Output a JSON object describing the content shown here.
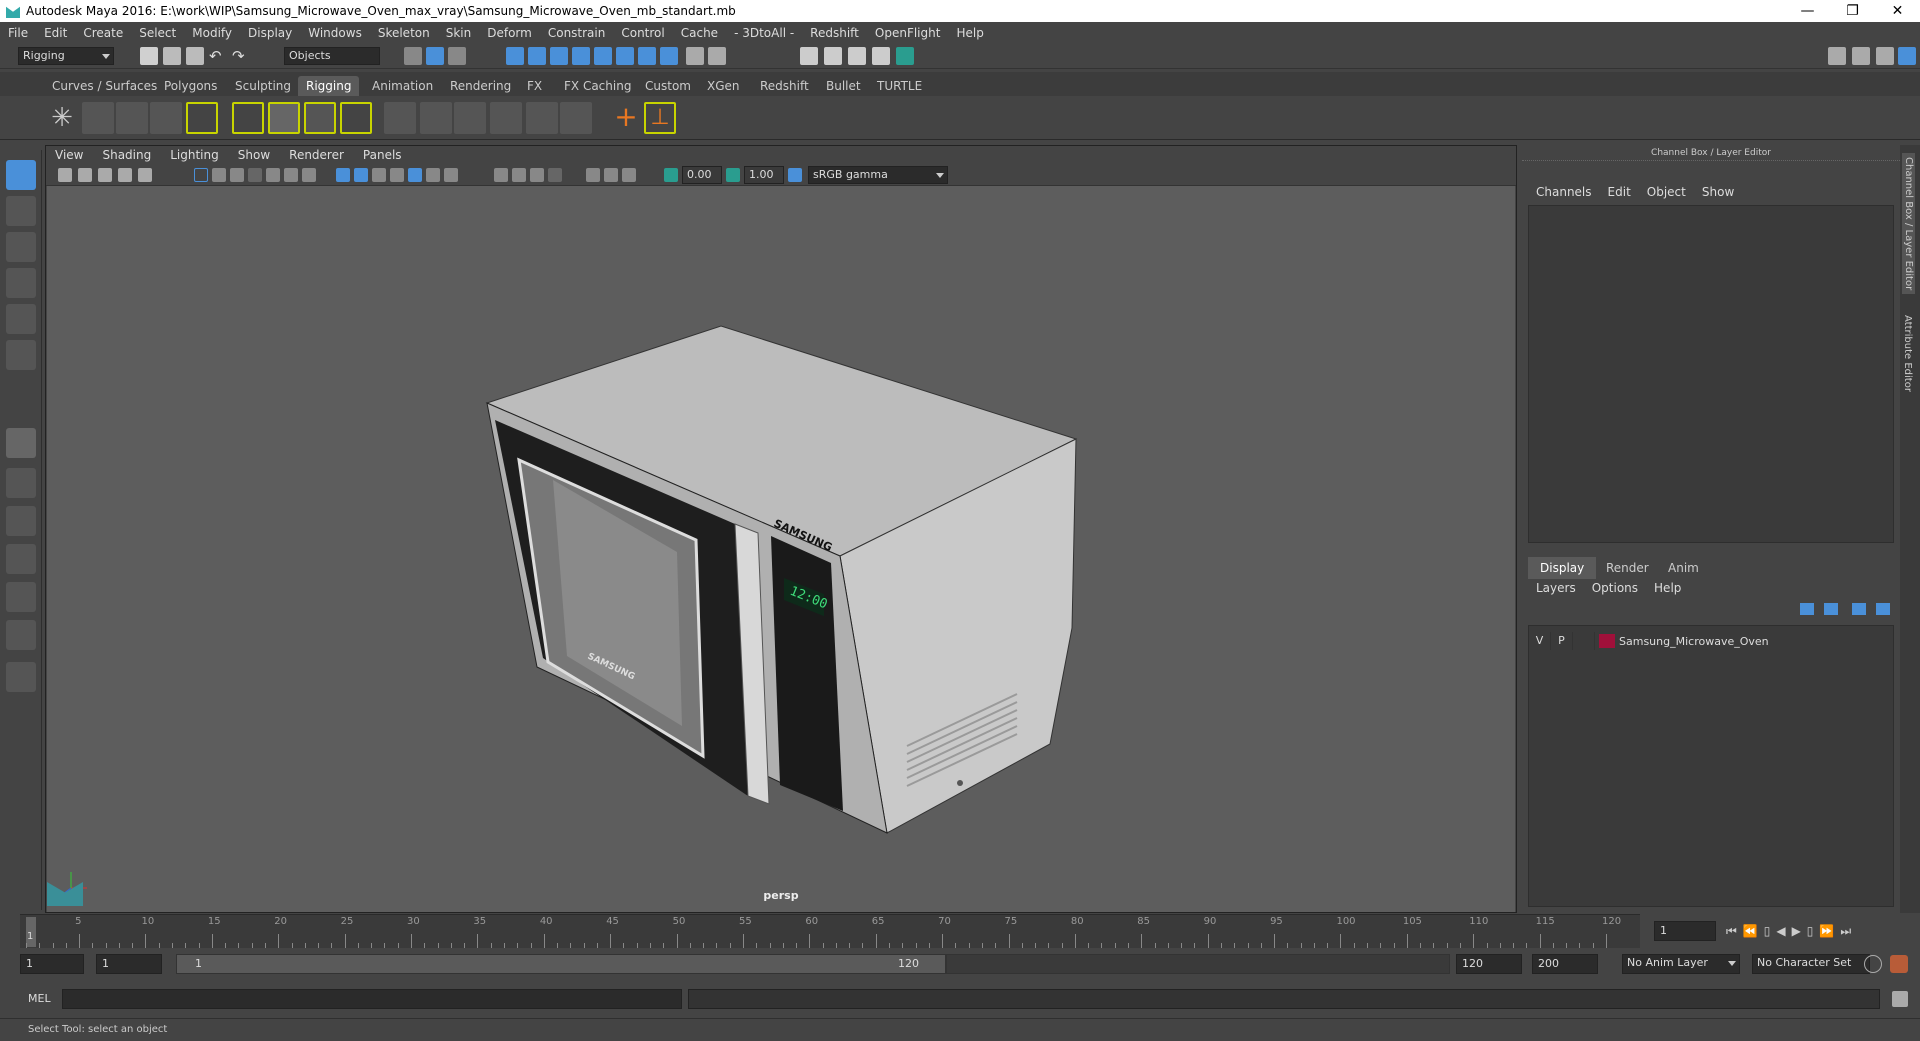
{
  "window": {
    "title": "Autodesk Maya 2016: E:\\work\\WIP\\Samsung_Microwave_Oven_max_vray\\Samsung_Microwave_Oven_mb_standart.mb",
    "minimize": "—",
    "maximize": "❐",
    "close": "✕"
  },
  "menubar": [
    "File",
    "Edit",
    "Create",
    "Select",
    "Modify",
    "Display",
    "Windows",
    "Skeleton",
    "Skin",
    "Deform",
    "Constrain",
    "Control",
    "Cache",
    "- 3DtoAll -",
    "Redshift",
    "OpenFlight",
    "Help"
  ],
  "statusline": {
    "menuset": "Rigging",
    "selection_mode": "Objects"
  },
  "shelf_tabs": [
    "Curves / Surfaces",
    "Polygons",
    "Sculpting",
    "Rigging",
    "Animation",
    "Rendering",
    "FX",
    "FX Caching",
    "Custom",
    "XGen",
    "Redshift",
    "Bullet",
    "TURTLE"
  ],
  "active_shelf_tab": "Rigging",
  "viewport": {
    "menu": [
      "View",
      "Shading",
      "Lighting",
      "Show",
      "Renderer",
      "Panels"
    ],
    "exposure": "0.00",
    "gamma": "1.00",
    "colorspace": "sRGB gamma",
    "camera": "persp",
    "model_text": {
      "brand_front": "SAMSUNG",
      "brand_door": "SAMSUNG",
      "display": "12:00"
    }
  },
  "channel_box": {
    "title": "Channel Box / Layer Editor",
    "menu": [
      "Channels",
      "Edit",
      "Object",
      "Show"
    ]
  },
  "layer_editor": {
    "tabs": [
      "Display",
      "Render",
      "Anim"
    ],
    "active_tab": "Display",
    "menu": [
      "Layers",
      "Options",
      "Help"
    ],
    "layers": [
      {
        "v": "V",
        "p": "P",
        "name": "Samsung_Microwave_Oven",
        "color": "#a0103a"
      }
    ]
  },
  "side_tabs": [
    "Channel Box / Layer Editor",
    "Attribute Editor"
  ],
  "timeline": {
    "ticks": [
      "5",
      "10",
      "15",
      "20",
      "25",
      "30",
      "35",
      "40",
      "45",
      "50",
      "55",
      "60",
      "65",
      "70",
      "75",
      "80",
      "85",
      "90",
      "95",
      "100",
      "105",
      "110",
      "115",
      "120"
    ],
    "start_marker": "1",
    "current_frame": "1"
  },
  "range": {
    "start": "1",
    "playback_start": "1",
    "slider_start": "1",
    "slider_end": "120",
    "playback_end": "120",
    "end": "200",
    "anim_layer": "No Anim Layer",
    "character_set": "No Character Set"
  },
  "cmdline": {
    "label": "MEL"
  },
  "helpline": "Select Tool: select an object",
  "colors": {
    "accent_blue": "#4a90d9",
    "viewport_bg": "#5d5d5d",
    "layer_color": "#a0103a"
  }
}
